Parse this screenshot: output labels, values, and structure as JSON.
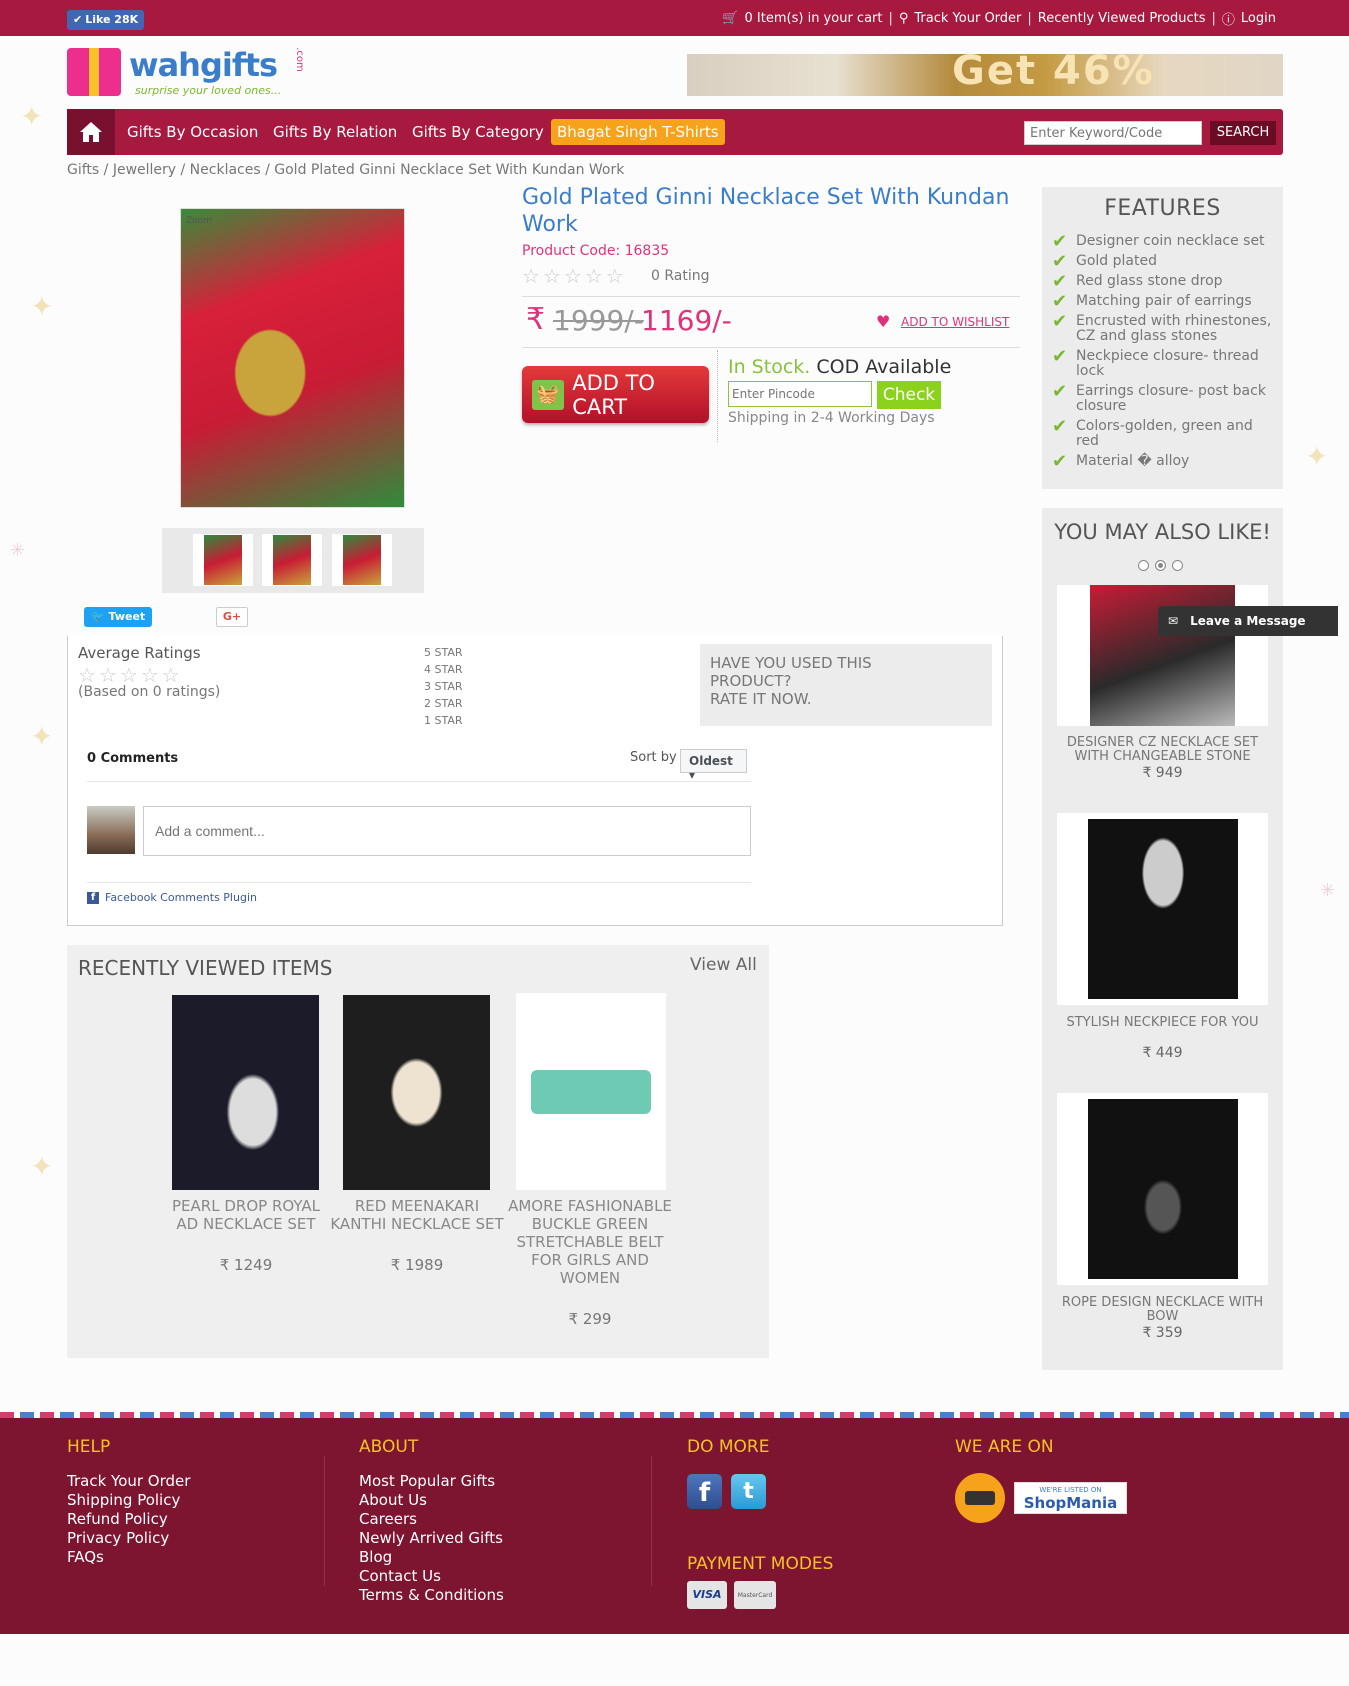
{
  "topbar": {
    "fb_like": "Like 28K",
    "cart": "0 Item(s) in your cart",
    "track_order": "Track Your Order",
    "recently_viewed": "Recently Viewed Products",
    "login": "Login"
  },
  "logo": {
    "brand": "wahgifts",
    "suffix": ".com",
    "tagline": "surprise your loved ones..."
  },
  "banner": {
    "text": "Get 46%"
  },
  "nav": {
    "items": [
      "Gifts By Occasion",
      "Gifts By Relation",
      "Gifts By Category",
      "Bhagat Singh T-Shirts"
    ],
    "search_placeholder": "Enter Keyword/Code",
    "search_button": "SEARCH"
  },
  "breadcrumb": "Gifts / Jewellery / Necklaces / Gold Plated Ginni Necklace Set With Kundan Work",
  "product": {
    "zoom": "Zoom",
    "title": "Gold Plated Ginni Necklace Set With Kundan Work",
    "code": "Product Code: 16835",
    "rating_text": "0 Rating",
    "rupee": "₹",
    "price_old": "1999/-",
    "price_new": "1169/-",
    "wishlist": "ADD TO WISHLIST",
    "add_to_cart": "ADD TO CART",
    "in_stock": "In Stock.",
    "cod": "COD Available",
    "pincode_placeholder": "Enter Pincode",
    "check": "Check",
    "shipping": "Shipping in 2-4 Working Days"
  },
  "share": {
    "tweet": "Tweet",
    "gplus": "G+"
  },
  "features": {
    "title": "FEATURES",
    "items": [
      "Designer coin necklace set",
      "Gold plated",
      "Red glass stone drop",
      "Matching pair of earrings",
      "Encrusted with rhinestones, CZ and glass stones",
      "Neckpiece closure- thread lock",
      "Earrings closure- post back closure",
      "Colors-golden, green and red",
      "Material � alloy"
    ]
  },
  "also_like": {
    "title": "YOU MAY ALSO LIKE!",
    "items": [
      {
        "name": "DESIGNER CZ NECKLACE SET WITH CHANGEABLE STONE",
        "price": "₹ 949"
      },
      {
        "name": "STYLISH NECKPIECE FOR YOU",
        "price": "₹ 449"
      },
      {
        "name": "ROPE DESIGN NECKLACE WITH BOW",
        "price": "₹ 359"
      }
    ]
  },
  "message_widget": "Leave a Message",
  "ratings": {
    "average_label": "Average Ratings",
    "based_on": "(Based on 0 ratings)",
    "star_rows": [
      "5 STAR",
      "4 STAR",
      "3 STAR",
      "2 STAR",
      "1 STAR"
    ],
    "rate_prompt_1": "HAVE YOU USED THIS",
    "rate_prompt_2": "PRODUCT?",
    "rate_prompt_3": "RATE IT NOW."
  },
  "comments": {
    "count": "0 Comments",
    "sort_by": "Sort by",
    "sort_value": "Oldest",
    "placeholder": "Add a comment...",
    "plugin": "Facebook Comments Plugin"
  },
  "recently_viewed": {
    "title": "RECENTLY VIEWED ITEMS",
    "view_all": "View All",
    "items": [
      {
        "name": "PEARL DROP ROYAL AD NECKLACE SET",
        "price": "₹ 1249"
      },
      {
        "name": "RED MEENAKARI KANTHI NECKLACE SET",
        "price": "₹ 1989"
      },
      {
        "name": "AMORE FASHIONABLE BUCKLE GREEN STRETCHABLE BELT FOR GIRLS AND WOMEN",
        "price": "₹ 299"
      }
    ]
  },
  "footer": {
    "help": {
      "title": "HELP",
      "links": [
        "Track Your Order",
        "Shipping Policy",
        "Refund Policy",
        "Privacy Policy",
        "FAQs"
      ]
    },
    "about": {
      "title": "ABOUT",
      "links": [
        "Most Popular Gifts",
        "About Us",
        "Careers",
        "Newly Arrived Gifts",
        "Blog",
        "Contact Us",
        "Terms & Conditions"
      ]
    },
    "do_more": "DO MORE",
    "we_are_on": "WE ARE ON",
    "shopmania_top": "WE'RE LISTED ON",
    "shopmania": "ShopMania",
    "payment_modes": "PAYMENT MODES",
    "visa": "VISA",
    "mastercard": "MasterCard"
  },
  "colors": {
    "brand": "#a8193f",
    "accent_pink": "#e0327a",
    "accent_green": "#86c23e",
    "title_blue": "#3a7dc9"
  }
}
